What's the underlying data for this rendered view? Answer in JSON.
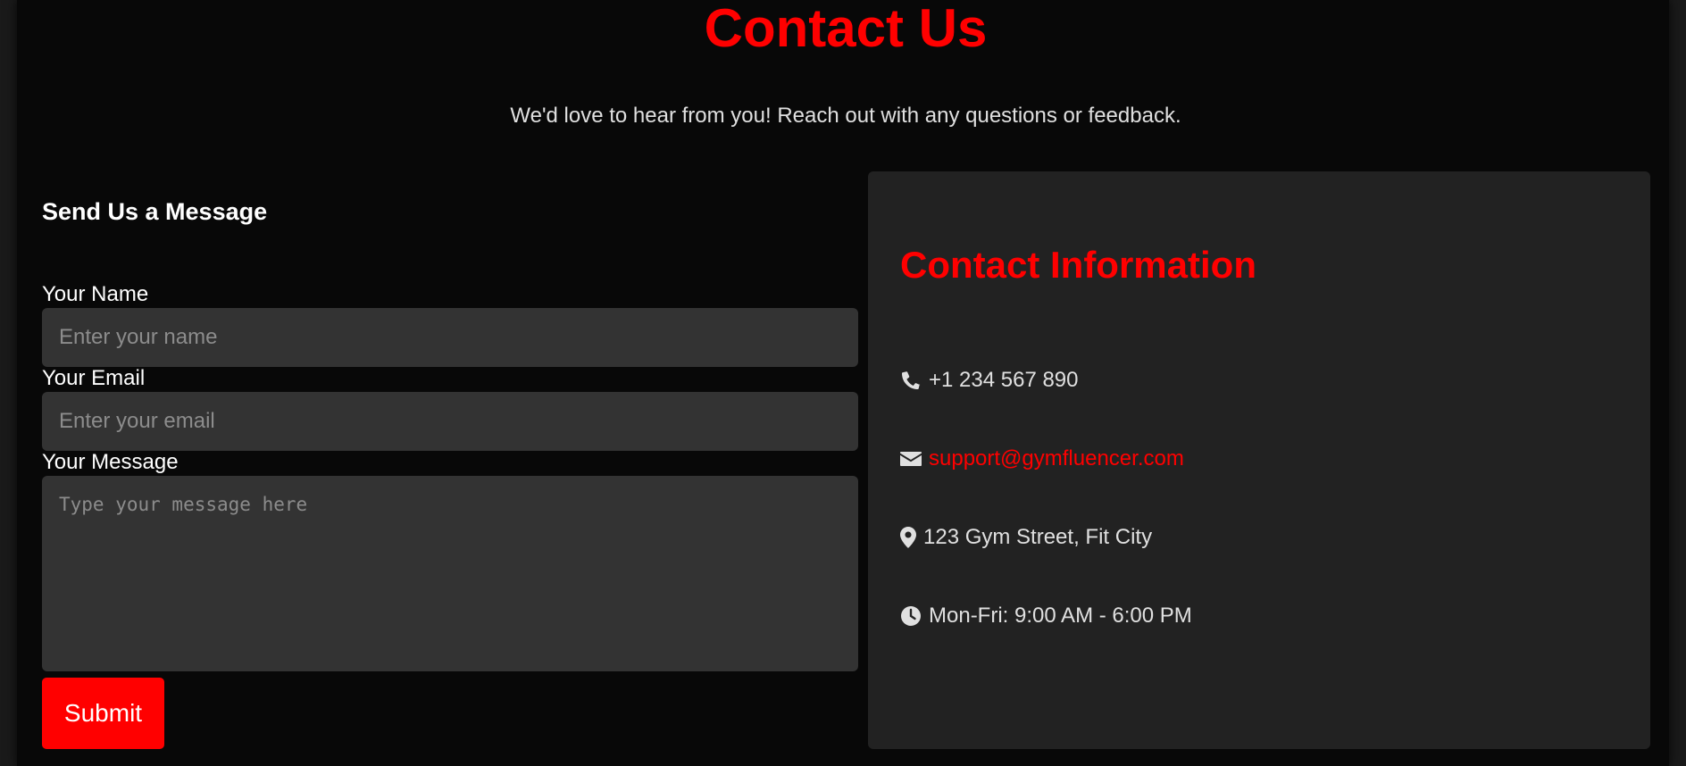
{
  "header": {
    "title": "Contact Us",
    "subtitle": "We'd love to hear from you! Reach out with any questions or feedback."
  },
  "form": {
    "heading": "Send Us a Message",
    "name_label": "Your Name",
    "name_placeholder": "Enter your name",
    "name_value": "",
    "email_label": "Your Email",
    "email_placeholder": "Enter your email",
    "email_value": "",
    "message_label": "Your Message",
    "message_placeholder": "Type your message here",
    "message_value": "",
    "submit_label": "Submit"
  },
  "contact_info": {
    "title": "Contact Information",
    "items": [
      {
        "icon": "phone-icon",
        "text": "+1 234 567 890"
      },
      {
        "icon": "envelope-icon",
        "text": "support@gymfluencer.com"
      },
      {
        "icon": "map-marker-icon",
        "text": "123 Gym Street, Fit City"
      },
      {
        "icon": "clock-icon",
        "text": "Mon-Fri: 9:00 AM - 6:00 PM"
      }
    ]
  },
  "colors": {
    "accent": "#ff0000",
    "background": "#080808",
    "panel": "#222222",
    "input": "#333333",
    "text": "#e0e0e0"
  }
}
